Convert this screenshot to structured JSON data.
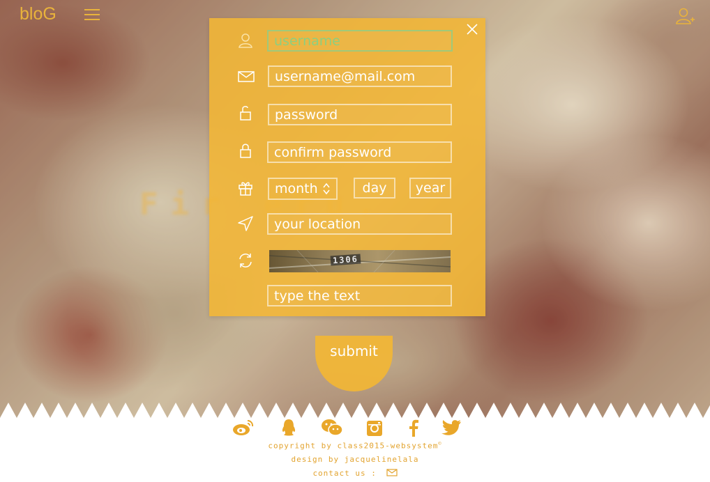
{
  "header": {
    "logo": "bloG"
  },
  "form": {
    "username_placeholder": "username",
    "email_placeholder": "username@mail.com",
    "password_placeholder": "password",
    "confirm_password_placeholder": "confirm password",
    "month_label": "month",
    "day_placeholder": "day",
    "year_placeholder": "year",
    "location_placeholder": "your location",
    "captcha_text": "1306",
    "captcha_input_placeholder": "type the text",
    "submit_label": "submit"
  },
  "background": {
    "blurred_heading": "Fir          eru."
  },
  "footer": {
    "copyright": "copyright by class2015-websystem",
    "copyright_symbol": "©",
    "design": "design by jacquelinelala",
    "contact_label": "contact us :"
  },
  "social_icons": [
    "weibo-icon",
    "qq-icon",
    "wechat-icon",
    "instagram-icon",
    "facebook-icon",
    "twitter-icon"
  ],
  "colors": {
    "accent": "#f2b635",
    "footer_text": "#e2a32e",
    "focus": "#9fc97a"
  }
}
